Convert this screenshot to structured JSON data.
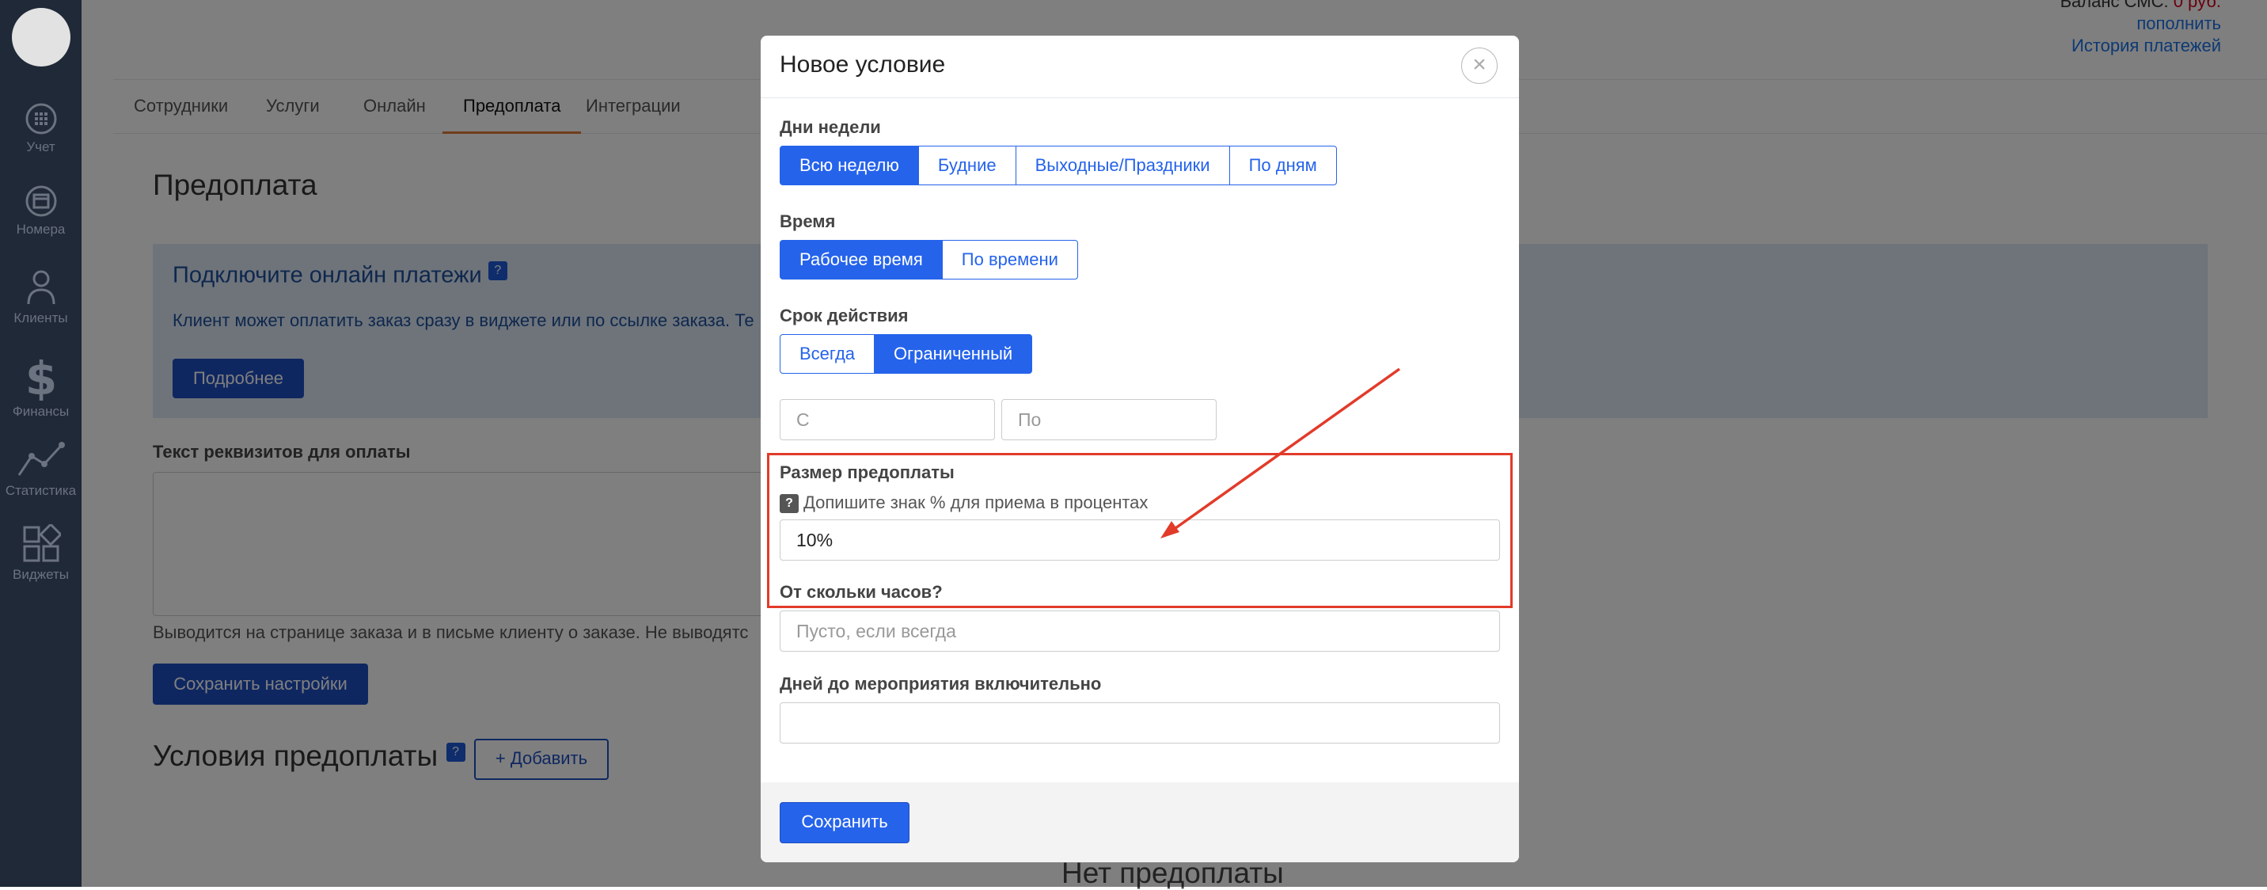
{
  "sidebar": {
    "items": [
      {
        "label": "Учет",
        "icon": "accounting-icon"
      },
      {
        "label": "Номера",
        "icon": "rooms-icon"
      },
      {
        "label": "Клиенты",
        "icon": "clients-icon"
      },
      {
        "label": "Финансы",
        "icon": "dollar-icon"
      },
      {
        "label": "Статистика",
        "icon": "statistics-icon"
      },
      {
        "label": "Виджеты",
        "icon": "widgets-icon"
      }
    ]
  },
  "header": {
    "balance_label": "Баланс СМС:",
    "balance_value": "0 руб.",
    "topup_link": "пополнить",
    "history_link": "История платежей"
  },
  "tabs": [
    "Сотрудники",
    "Услуги",
    "Онлайн",
    "Предоплата",
    "Интеграции"
  ],
  "active_tab": "Предоплата",
  "page": {
    "title": "Предоплата",
    "promo_title": "Подключите онлайн платежи",
    "promo_text": "Клиент может оплатить заказ сразу в виджете или по ссылке заказа. Те",
    "promo_button": "Подробнее",
    "requisites_label": "Текст реквизитов для оплаты",
    "requisites_help": "Выводится на странице заказа и в письме клиенту о заказе. Не выводятс",
    "save_settings_button": "Сохранить настройки",
    "conditions_title": "Условия предоплаты",
    "add_button": "+ Добавить",
    "no_prepayment": "Нет предоплаты"
  },
  "modal": {
    "title": "Новое условие",
    "days_label": "Дни недели",
    "days_options": [
      "Всю неделю",
      "Будние",
      "Выходные/Праздники",
      "По дням"
    ],
    "days_selected": "Всю неделю",
    "time_label": "Время",
    "time_options": [
      "Рабочее время",
      "По времени"
    ],
    "time_selected": "Рабочее время",
    "validity_label": "Срок действия",
    "validity_options": [
      "Всегда",
      "Ограниченный"
    ],
    "validity_selected": "Ограниченный",
    "from_placeholder": "С",
    "to_placeholder": "По",
    "prepay_size_label": "Размер предоплаты",
    "prepay_hint": "Допишите знак % для приема в процентах",
    "prepay_value": "10%",
    "hours_label": "От скольки часов?",
    "hours_placeholder": "Пусто, если всегда",
    "days_before_label": "Дней до мероприятия включительно",
    "days_before_value": "",
    "save_button": "Сохранить"
  },
  "colors": {
    "accent": "#2563eb",
    "sidebar": "#1f2937",
    "highlight": "#e23b2a",
    "active_tab_underline": "#e07b39"
  }
}
